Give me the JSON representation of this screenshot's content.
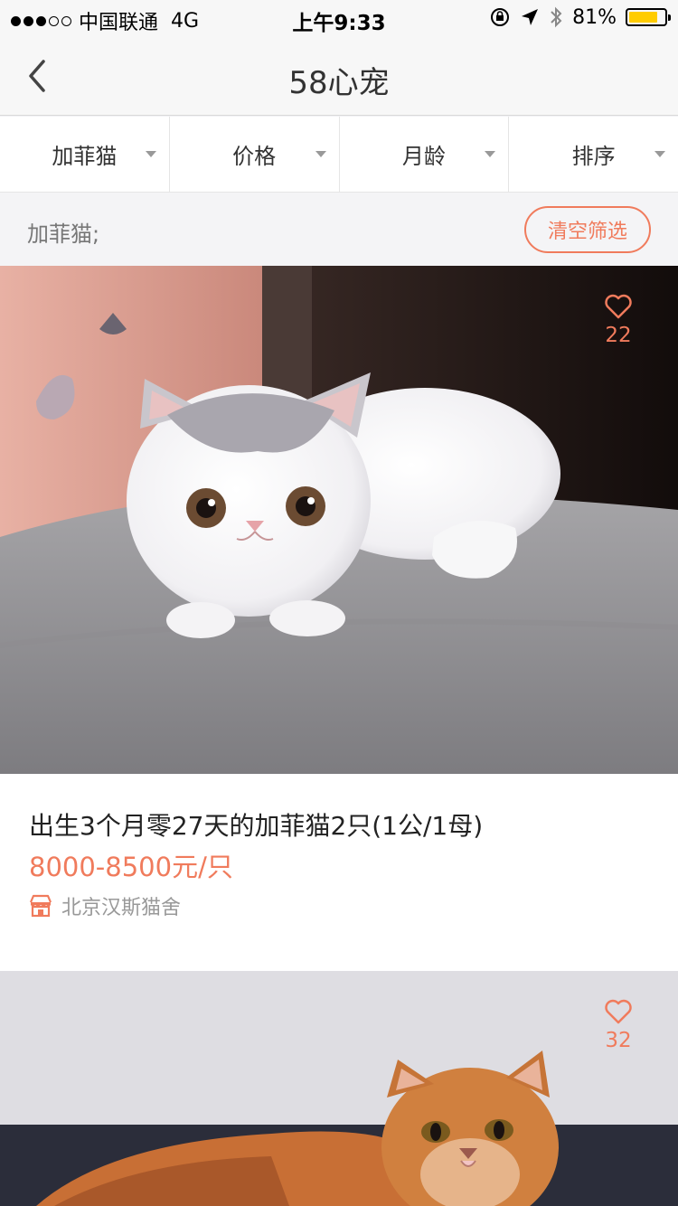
{
  "status_bar": {
    "carrier": "中国联通",
    "network": "4G",
    "time": "上午9:33",
    "battery_percent": "81%",
    "battery_level": 0.81
  },
  "nav": {
    "title": "58心宠",
    "back_icon": "chevron-left-icon"
  },
  "filters": [
    {
      "label": "加菲猫"
    },
    {
      "label": "价格"
    },
    {
      "label": "月龄"
    },
    {
      "label": "排序"
    }
  ],
  "selection": {
    "text": "加菲猫;",
    "clear_label": "清空筛选"
  },
  "listings": [
    {
      "title": "出生3个月零27天的加菲猫2只(1公/1母)",
      "price": "8000-8500元/只",
      "shop": "北京汉斯猫舍",
      "likes": "22"
    },
    {
      "likes": "32"
    }
  ],
  "colors": {
    "accent": "#f07b5c",
    "text_primary": "#222222",
    "text_secondary": "#999999",
    "background": "#f2f2f4"
  }
}
